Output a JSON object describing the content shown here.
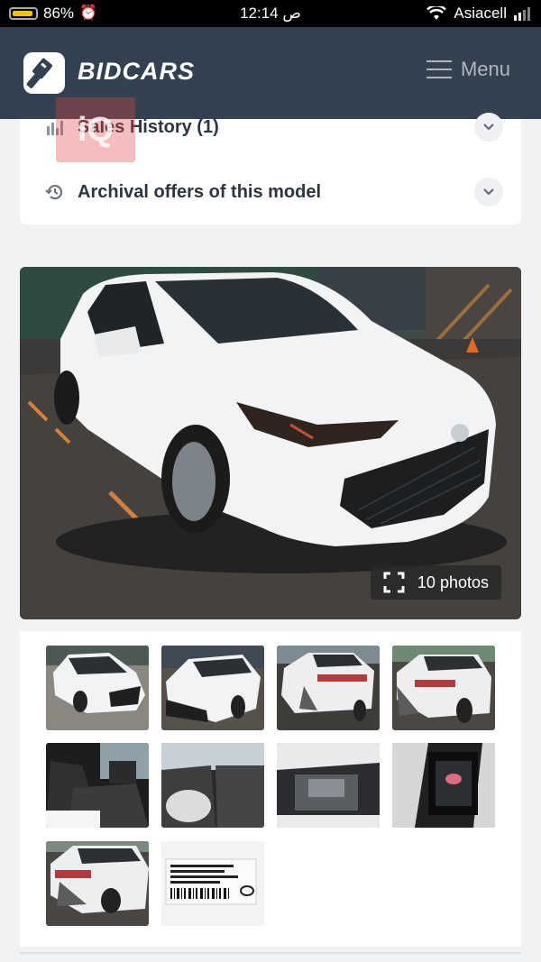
{
  "status_bar": {
    "battery": "86%",
    "time": "12:14 ص",
    "carrier": "Asiacell"
  },
  "header": {
    "brand": "BIDCARS",
    "menu_label": "Menu"
  },
  "accordion": {
    "items": [
      {
        "label": "Sales History (1)",
        "icon": "bar-chart-icon"
      },
      {
        "label": "Archival offers of this model",
        "icon": "history-icon"
      }
    ]
  },
  "overlay": {
    "text": "iQ"
  },
  "gallery": {
    "photos_label": "10 photos",
    "thumbnail_count": 10
  },
  "colors": {
    "header_bg": "#344150",
    "page_bg": "#f0f2f4"
  }
}
